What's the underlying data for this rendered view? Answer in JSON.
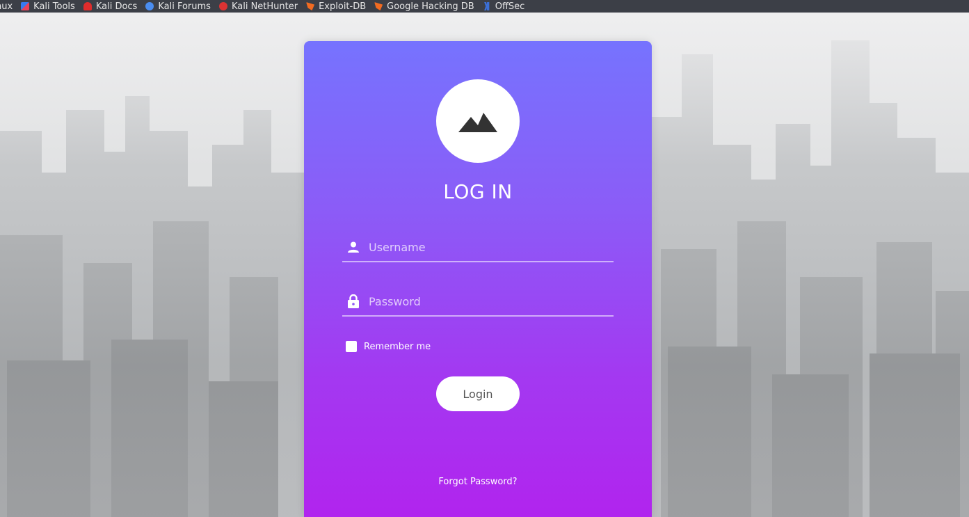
{
  "bookmarks": [
    {
      "label": "nux",
      "icon": "none"
    },
    {
      "label": "Kali Tools",
      "icon": "kali-tools-icon"
    },
    {
      "label": "Kali Docs",
      "icon": "kali-docs-icon"
    },
    {
      "label": "Kali Forums",
      "icon": "kali-forums-icon"
    },
    {
      "label": "Kali NetHunter",
      "icon": "kali-nethunter-icon"
    },
    {
      "label": "Exploit-DB",
      "icon": "exploit-db-icon"
    },
    {
      "label": "Google Hacking DB",
      "icon": "google-hacking-db-icon"
    },
    {
      "label": "OffSec",
      "icon": "offsec-icon"
    }
  ],
  "login": {
    "title": "LOG IN",
    "avatar_icon": "mountain-icon",
    "username_placeholder": "Username",
    "username_value": "",
    "username_icon": "user-icon",
    "password_placeholder": "Password",
    "password_value": "",
    "password_icon": "lock-icon",
    "remember_label": "Remember me",
    "remember_checked": false,
    "login_label": "Login",
    "forgot_label": "Forgot Password?"
  },
  "colors": {
    "card_top": "#7673fe",
    "card_bottom": "#b124ee",
    "bookmarks_bg": "#3c3f47",
    "button_text": "#555555"
  }
}
